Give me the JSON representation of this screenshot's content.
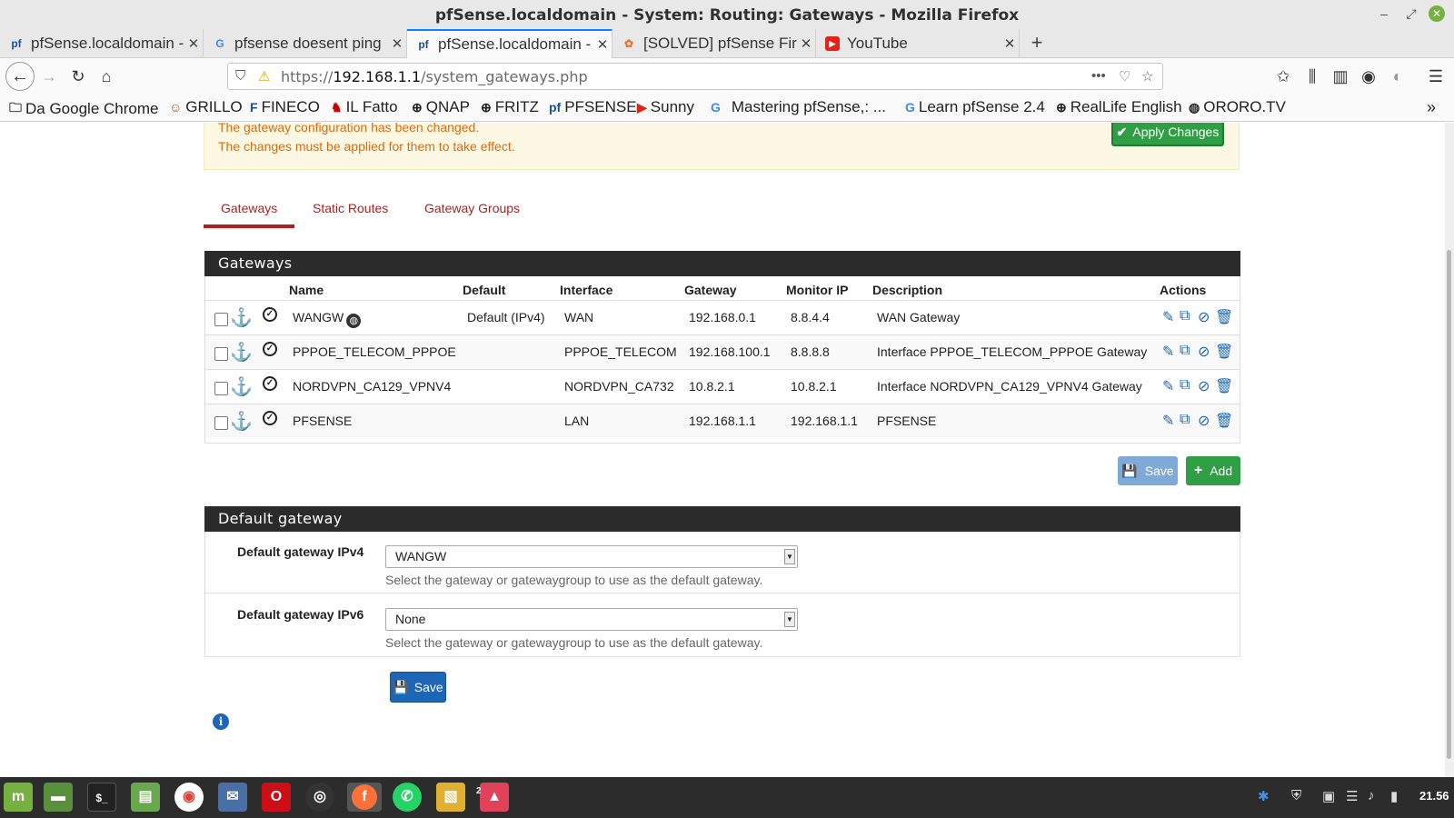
{
  "window": {
    "title": "pfSense.localdomain - System: Routing: Gateways - Mozilla Firefox"
  },
  "tabs": [
    {
      "label": "pfSense.localdomain - ",
      "icon": "pfsense-icon"
    },
    {
      "label": "pfsense doesent ping",
      "icon": "google-icon"
    },
    {
      "label": "pfSense.localdomain - ",
      "icon": "pfsense-icon"
    },
    {
      "label": "[SOLVED] pfSense Fire",
      "icon": "forum-icon"
    },
    {
      "label": "YouTube",
      "icon": "youtube-icon"
    }
  ],
  "nav": {
    "url_prefix": "https://",
    "url_host": "192.168.1.1",
    "url_path": "/system_gateways.php"
  },
  "bookmarks": [
    {
      "label": "Da Google Chrome",
      "icon": "folder-icon"
    },
    {
      "label": "GRILLO",
      "icon": "grillo-icon"
    },
    {
      "label": "FINECO",
      "icon": "fineco-icon"
    },
    {
      "label": "IL Fatto",
      "icon": "ilfatto-icon"
    },
    {
      "label": "QNAP",
      "icon": "globe-icon"
    },
    {
      "label": "FRITZ",
      "icon": "globe-icon"
    },
    {
      "label": "PFSENSE",
      "icon": "pfsense-icon"
    },
    {
      "label": "Sunny",
      "icon": "youtube-icon"
    },
    {
      "label": "Mastering pfSense,: ...",
      "icon": "google-icon"
    },
    {
      "label": "Learn pfSense 2.4",
      "icon": "google-icon"
    },
    {
      "label": "RealLife English",
      "icon": "globe-icon"
    },
    {
      "label": "ORORO.TV",
      "icon": "ororo-icon"
    }
  ],
  "alert": {
    "line1": "The gateway configuration has been changed.",
    "line2": "The changes must be applied for them to take effect.",
    "apply_label": "Apply Changes"
  },
  "subnav": {
    "tab1": "Gateways",
    "tab2": "Static Routes",
    "tab3": "Gateway Groups"
  },
  "gateways": {
    "title": "Gateways",
    "columns": {
      "name": "Name",
      "default": "Default",
      "interface": "Interface",
      "gateway": "Gateway",
      "monitor": "Monitor IP",
      "description": "Description",
      "actions": "Actions"
    },
    "rows": [
      {
        "name": "WANGW",
        "default": "Default (IPv4)",
        "interface": "WAN",
        "gateway": "192.168.0.1",
        "monitor": "8.8.4.4",
        "description": "WAN Gateway"
      },
      {
        "name": "PPPOE_TELECOM_PPPOE",
        "default": "",
        "interface": "PPPOE_TELECOM",
        "gateway": "192.168.100.1",
        "monitor": "8.8.8.8",
        "description": "Interface PPPOE_TELECOM_PPPOE Gateway"
      },
      {
        "name": "NORDVPN_CA129_VPNV4",
        "default": "",
        "interface": "NORDVPN_CA732",
        "gateway": "10.8.2.1",
        "monitor": "10.8.2.1",
        "description": "Interface NORDVPN_CA129_VPNV4 Gateway"
      },
      {
        "name": "PFSENSE",
        "default": "",
        "interface": "LAN",
        "gateway": "192.168.1.1",
        "monitor": "192.168.1.1",
        "description": "PFSENSE"
      }
    ],
    "save_label": "Save",
    "add_label": "Add"
  },
  "default_gateway": {
    "title": "Default gateway",
    "ipv4_label": "Default gateway IPv4",
    "ipv4_value": "WANGW",
    "ipv6_label": "Default gateway IPv6",
    "ipv6_value": "None",
    "help": "Select the gateway or gatewaygroup to use as the default gateway.",
    "save_label": "Save"
  },
  "taskbar": {
    "clock": "21.56",
    "badge": "2"
  },
  "colors": {
    "accent": "#b71c1c",
    "primary": "#1c65b7",
    "success": "#2f9e44",
    "panel_head": "#2b2b2b"
  }
}
